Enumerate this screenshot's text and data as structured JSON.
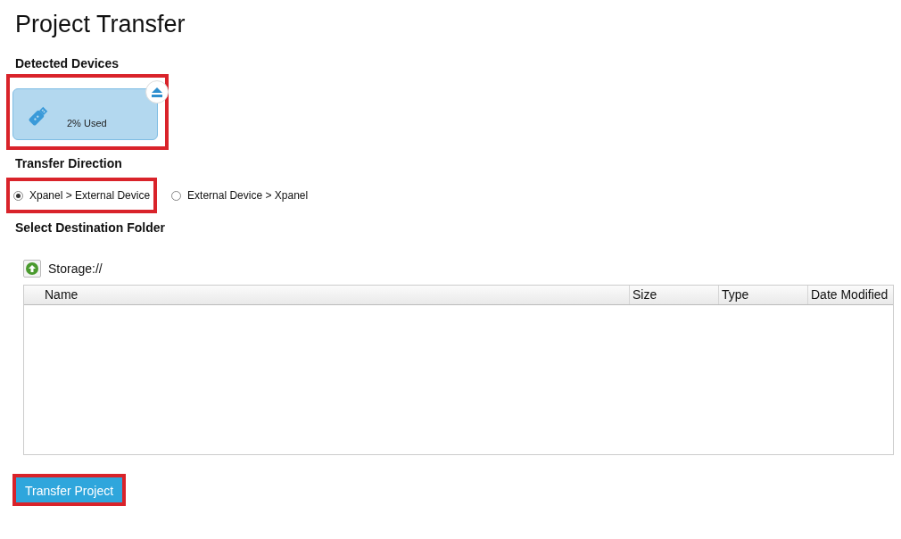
{
  "title": "Project Transfer",
  "devices_section": {
    "heading": "Detected Devices",
    "devices": [
      {
        "usage": "2% Used",
        "highlighted": true
      }
    ]
  },
  "direction_section": {
    "heading": "Transfer Direction",
    "options": [
      {
        "label": "Xpanel > External Device",
        "selected": true,
        "highlighted": true
      },
      {
        "label": "External Device > Xpanel",
        "selected": false,
        "highlighted": false
      }
    ]
  },
  "destination_section": {
    "heading": "Select Destination Folder",
    "path": "Storage://",
    "table": {
      "columns": [
        "Name",
        "Size",
        "Type",
        "Date Modified"
      ]
    }
  },
  "action_button": {
    "label": "Transfer Project",
    "highlighted": true
  }
}
